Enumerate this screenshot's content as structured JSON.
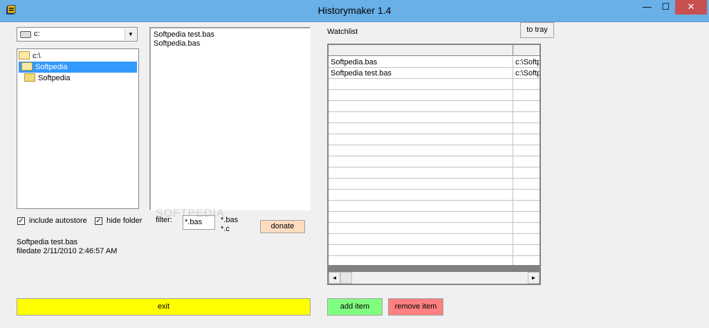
{
  "window": {
    "title": "Historymaker 1.4",
    "minimize": "—",
    "maximize": "☐",
    "close": "✕"
  },
  "drive": {
    "value": "c:",
    "arrow": "▼"
  },
  "directories": [
    {
      "label": "c:\\",
      "selected": false,
      "indent": 0
    },
    {
      "label": "Softpedia",
      "selected": true,
      "indent": 1
    },
    {
      "label": "Softpedia",
      "selected": false,
      "indent": 2
    }
  ],
  "files": [
    "Softpedia test.bas",
    "Softpedia.bas"
  ],
  "options": {
    "include_autostore": {
      "label": "include autostore",
      "checked": "✓"
    },
    "hide_folder": {
      "label": "hide folder",
      "checked": "✓"
    }
  },
  "filter": {
    "label": "filter:",
    "value": "*.bas",
    "ext1": "*.bas",
    "ext2": "*.c"
  },
  "donate_label": "donate",
  "info": {
    "filename": "Softpedia test.bas",
    "filedate": "filedate 2/11/2010 2:46:57 AM"
  },
  "exit_label": "exit",
  "watchlist": {
    "label": "Watchlist",
    "to_tray_label": "to tray",
    "rows": [
      {
        "name": "Softpedia.bas",
        "path": "c:\\Softp"
      },
      {
        "name": "Softpedia test.bas",
        "path": "c:\\Softp"
      }
    ],
    "scroll_left": "◄",
    "scroll_right": "►"
  },
  "add_item_label": "add item",
  "remove_item_label": "remove item",
  "colors": {
    "titlebar": "#6ab0e8",
    "selection": "#3399ff",
    "exit_button": "#ffff00",
    "add_button": "#80ff80",
    "remove_button": "#ff8080",
    "donate_button": "#ffdcc0"
  },
  "watermark": "SOFTPEDIA"
}
